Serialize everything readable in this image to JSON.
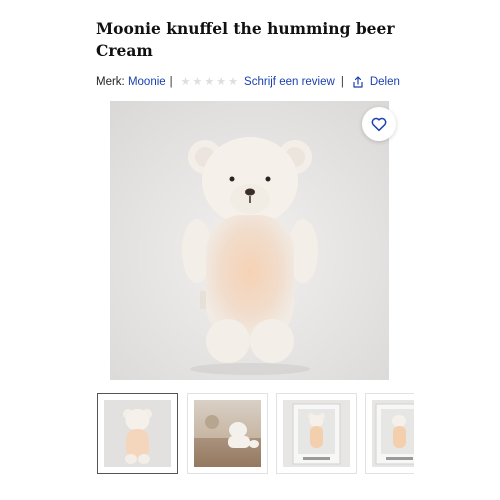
{
  "product": {
    "title": "Moonie knuffel the humming beer Cream"
  },
  "meta": {
    "brand_label": "Merk:",
    "brand_name": "Moonie",
    "separator": "|",
    "rating_stars": 5,
    "rating_filled": 0,
    "review_link": "Schrijf een review",
    "share_label": "Delen"
  },
  "icons": {
    "favorite": "heart-outline-icon",
    "share": "share-icon",
    "star": "star-icon"
  },
  "colors": {
    "link": "#1a3fb0",
    "star_empty": "#dedede",
    "title": "#111111"
  },
  "gallery": {
    "selected_index": 0,
    "thumbnails": [
      {
        "name": "thumb-bear-glowing"
      },
      {
        "name": "thumb-bear-lifestyle"
      },
      {
        "name": "thumb-bear-in-box"
      },
      {
        "name": "thumb-bear-box-partial"
      }
    ]
  }
}
